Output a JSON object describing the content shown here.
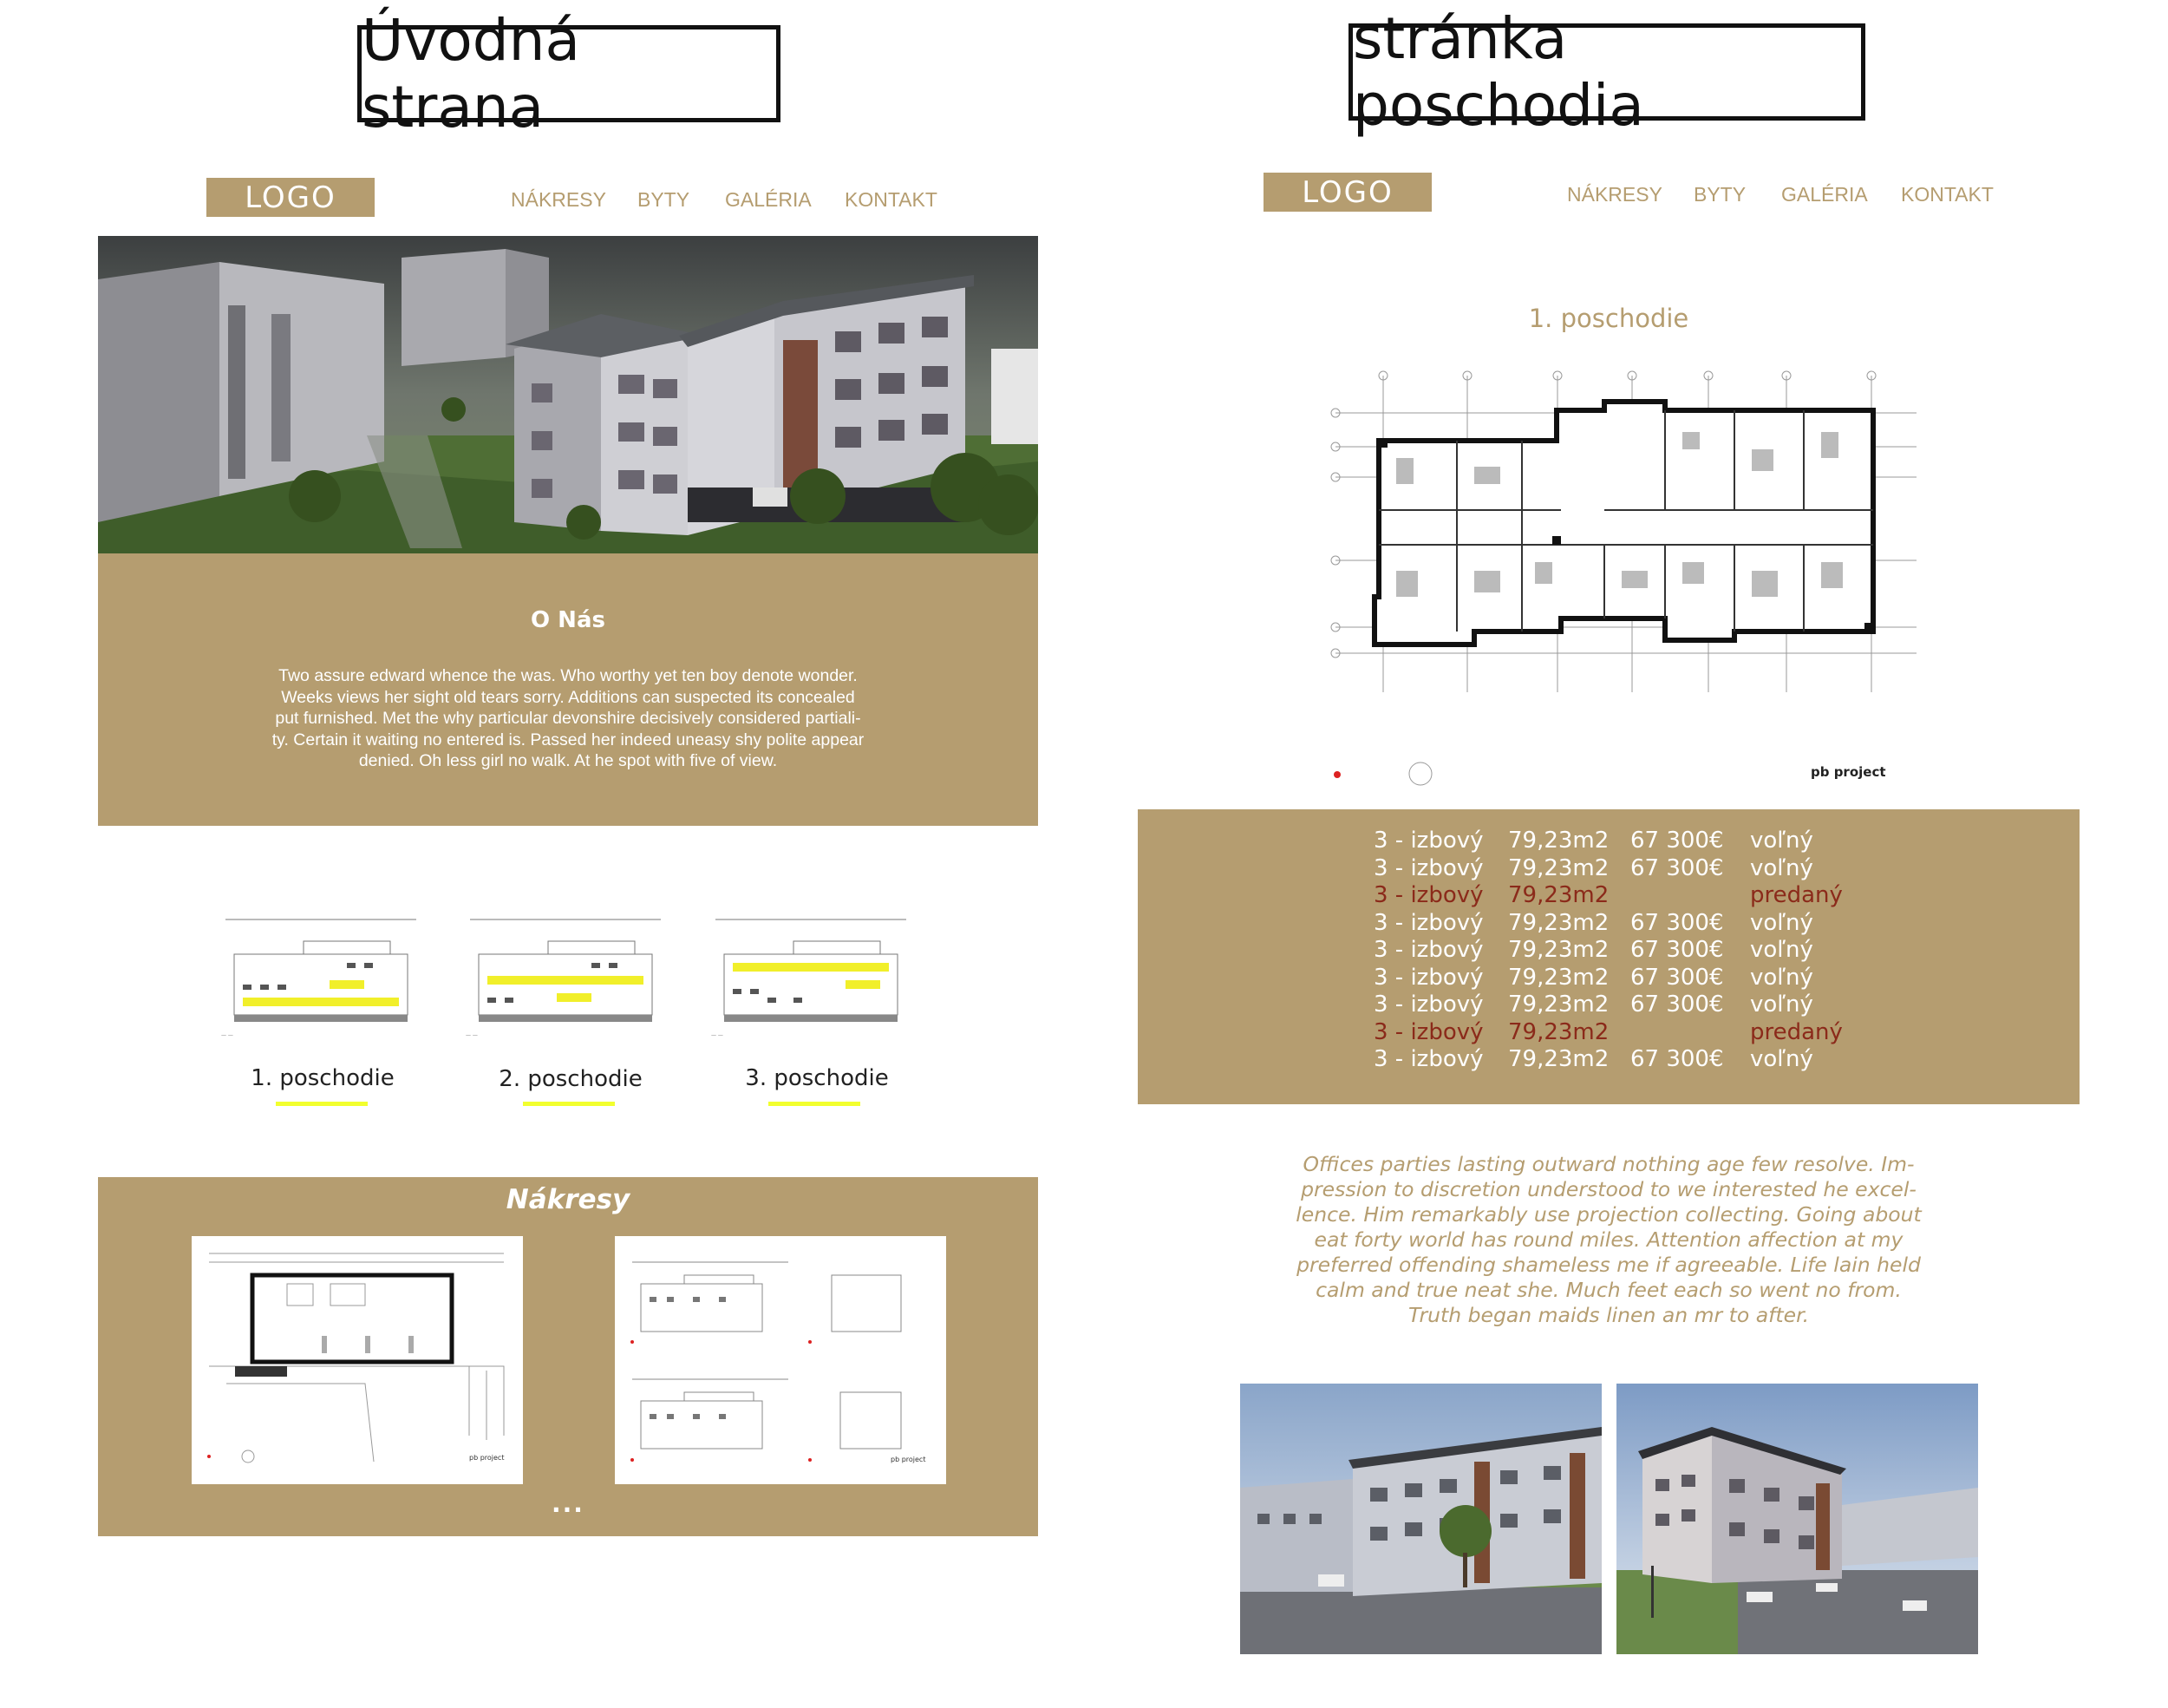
{
  "left": {
    "heading": "Úvodná strana",
    "logo": "LOGO",
    "nav": [
      "NÁKRESY",
      "BYTY",
      "GALÉRIA",
      "KONTAKT"
    ],
    "about": {
      "title": "O Nás",
      "text_lines": [
        "Two assure edward whence the was. Who worthy yet ten boy denote wonder.",
        "Weeks views her sight old tears sorry. Additions can suspected its concealed",
        "put furnished. Met the why particular devonshire decisively considered partiali-",
        "ty. Certain it waiting no entered is. Passed her indeed uneasy shy polite appear",
        "denied. Oh less girl no walk. At he spot with five of view."
      ]
    },
    "floors": [
      "1. poschodie",
      "2. poschodie",
      "3. poschodie"
    ],
    "nakresy": {
      "title": "Nákresy",
      "more": "..."
    }
  },
  "right": {
    "heading": "stránka poschodia",
    "logo": "LOGO",
    "nav": [
      "NÁKRESY",
      "BYTY",
      "GALÉRIA",
      "KONTAKT"
    ],
    "floor_title": "1. poschodie",
    "plan_brand": "pb project",
    "apartments": [
      {
        "type": "3 - izbový",
        "area": "79,23m2",
        "price": "67 300€",
        "status": "voľný",
        "sold": false
      },
      {
        "type": "3 - izbový",
        "area": "79,23m2",
        "price": "67 300€",
        "status": "voľný",
        "sold": false
      },
      {
        "type": "3 - izbový",
        "area": "79,23m2",
        "price": "",
        "status": "predaný",
        "sold": true
      },
      {
        "type": "3 - izbový",
        "area": "79,23m2",
        "price": "67 300€",
        "status": "voľný",
        "sold": false
      },
      {
        "type": "3 - izbový",
        "area": "79,23m2",
        "price": "67 300€",
        "status": "voľný",
        "sold": false
      },
      {
        "type": "3 - izbový",
        "area": "79,23m2",
        "price": "67 300€",
        "status": "voľný",
        "sold": false
      },
      {
        "type": "3 - izbový",
        "area": "79,23m2",
        "price": "67 300€",
        "status": "voľný",
        "sold": false
      },
      {
        "type": "3 - izbový",
        "area": "79,23m2",
        "price": "",
        "status": "predaný",
        "sold": true
      },
      {
        "type": "3 - izbový",
        "area": "79,23m2",
        "price": "67 300€",
        "status": "voľný",
        "sold": false
      }
    ],
    "quote_lines": [
      "Offices parties lasting outward nothing age few resolve. Im-",
      "pression to discretion understood to we interested he excel-",
      "lence. Him remarkably use projection collecting. Going about",
      "eat forty world has round miles. Attention affection at my",
      "preferred offending shameless me if agreeable. Life lain held",
      "calm and true neat she. Much feet each so went no from.",
      "Truth began maids linen an mr to after."
    ]
  },
  "colors": {
    "accent": "#b59d70",
    "sold": "#8b2a1a",
    "highlight": "#f2ff2e"
  }
}
